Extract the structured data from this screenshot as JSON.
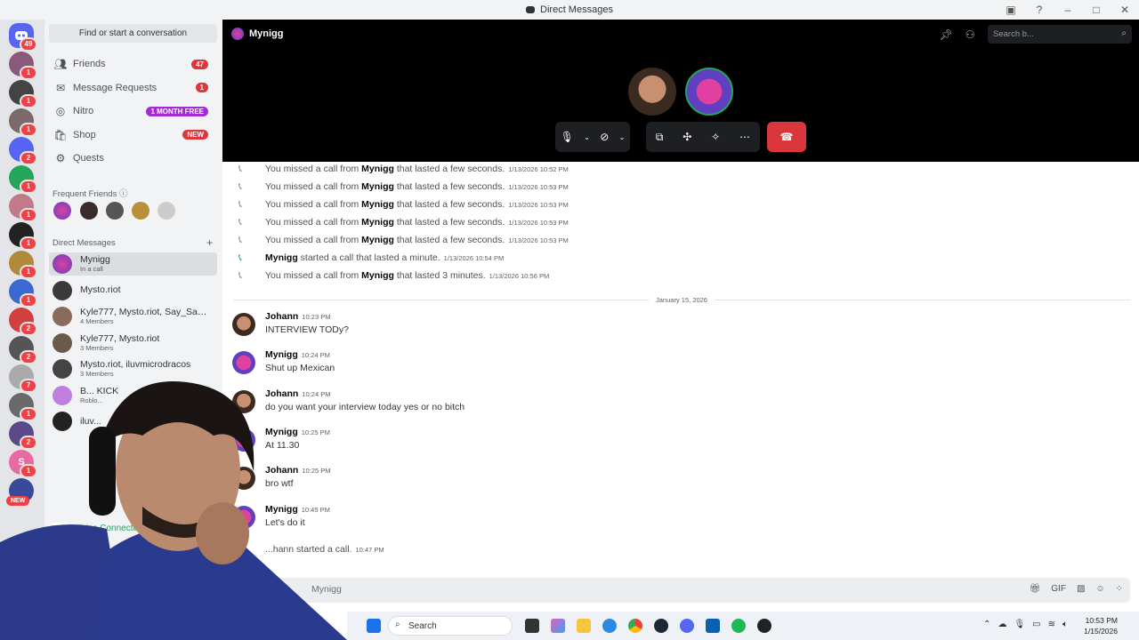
{
  "window": {
    "title": "Direct Messages"
  },
  "rail": {
    "home_badge": "49",
    "servers": [
      {
        "badge": "1",
        "color": "#8a5a7a"
      },
      {
        "badge": "1",
        "color": "#444"
      },
      {
        "badge": "1",
        "color": "#7a6a6a"
      },
      {
        "badge": "2",
        "color": "#5865f2"
      },
      {
        "badge": "1",
        "color": "#23a55a"
      },
      {
        "badge": "1",
        "color": "#c07a8a"
      },
      {
        "badge": "1",
        "color": "#222"
      },
      {
        "badge": "1",
        "color": "#b08a3a"
      },
      {
        "badge": "1",
        "color": "#3a6ad0"
      },
      {
        "badge": "2",
        "color": "#d04040"
      },
      {
        "badge": "2",
        "color": "#555"
      },
      {
        "badge": "7",
        "color": "#aaa"
      },
      {
        "badge": "1",
        "color": "#6a6a6a"
      },
      {
        "badge": "2",
        "color": "#5a4a8a"
      },
      {
        "badge": "1",
        "color": "#e86aa0",
        "letter": "S"
      },
      {
        "badge": "",
        "color": "#3a4a9a"
      }
    ],
    "new_label": "NEW"
  },
  "sidebar": {
    "find_placeholder": "Find or start a conversation",
    "nav": [
      {
        "label": "Friends",
        "badge": "47",
        "icon": "friends-icon"
      },
      {
        "label": "Message Requests",
        "badge": "1",
        "icon": "mail-icon"
      },
      {
        "label": "Nitro",
        "badge": "1 MONTH FREE",
        "icon": "nitro-icon"
      },
      {
        "label": "Shop",
        "badge": "NEW",
        "icon": "shop-icon"
      },
      {
        "label": "Quests",
        "badge": "",
        "icon": "quests-icon"
      }
    ],
    "frequent_friends_label": "Frequent Friends",
    "direct_messages_label": "Direct Messages",
    "dms": [
      {
        "name": "Mynigg",
        "sub": "In a call"
      },
      {
        "name": "Mysto.riot",
        "sub": ""
      },
      {
        "name": "Kyle777, Mysto.riot, Say_Say1...",
        "sub": "4 Members"
      },
      {
        "name": "Kyle777, Mysto.riot",
        "sub": "3 Members"
      },
      {
        "name": "Mysto.riot, iluvmicrodracos",
        "sub": "3 Members"
      },
      {
        "name": "B... KICK",
        "sub": "Roblo..."
      },
      {
        "name": "iluv...",
        "sub": ""
      }
    ],
    "voice": {
      "status": "Voice Connecte...",
      "channel": "Mynigg"
    }
  },
  "call": {
    "channel_name": "Mynigg",
    "search_placeholder": "Search b..."
  },
  "messages": {
    "system": [
      {
        "pre": "You missed a call from ",
        "who": "Mynigg",
        "post": " that lasted a few seconds.",
        "time": "1/13/2026 10:52 PM",
        "missed": true
      },
      {
        "pre": "You missed a call from ",
        "who": "Mynigg",
        "post": " that lasted a few seconds.",
        "time": "1/13/2026 10:53 PM",
        "missed": true
      },
      {
        "pre": "You missed a call from ",
        "who": "Mynigg",
        "post": " that lasted a few seconds.",
        "time": "1/13/2026 10:53 PM",
        "missed": true
      },
      {
        "pre": "You missed a call from ",
        "who": "Mynigg",
        "post": " that lasted a few seconds.",
        "time": "1/13/2026 10:53 PM",
        "missed": true
      },
      {
        "pre": "You missed a call from ",
        "who": "Mynigg",
        "post": " that lasted a few seconds.",
        "time": "1/13/2026 10:53 PM",
        "missed": true
      },
      {
        "pre": "",
        "who": "Mynigg",
        "post": " started a call that lasted a minute.",
        "time": "1/13/2026 10:54 PM",
        "missed": false
      },
      {
        "pre": "You missed a call from ",
        "who": "Mynigg",
        "post": " that lasted 3 minutes.",
        "time": "1/13/2026 10:56 PM",
        "missed": true
      }
    ],
    "date_divider": "January 15, 2026",
    "chat": [
      {
        "author": "Johann",
        "time": "10:23 PM",
        "text": "INTERVIEW TODy?"
      },
      {
        "author": "Mynigg",
        "time": "10:24 PM",
        "text": "Shut up Mexican"
      },
      {
        "author": "Johann",
        "time": "10:24 PM",
        "text": "do you want your interview today yes or no bitch"
      },
      {
        "author": "Mynigg",
        "time": "10:25 PM",
        "text": "At 11.30"
      },
      {
        "author": "Johann",
        "time": "10:25 PM",
        "text": "bro wtf"
      },
      {
        "author": "Mynigg",
        "time": "10:45 PM",
        "text": "Let's do it"
      }
    ],
    "last": {
      "text": "...hann started a call.",
      "time": "10:47 PM"
    }
  },
  "composer": {
    "placeholder": "Mynigg"
  },
  "taskbar": {
    "search_label": "Search",
    "time": "10:53 PM",
    "date": "1/15/2026"
  },
  "colors": {
    "accent": "#5865f2",
    "danger": "#da373c",
    "online": "#23a55a"
  }
}
